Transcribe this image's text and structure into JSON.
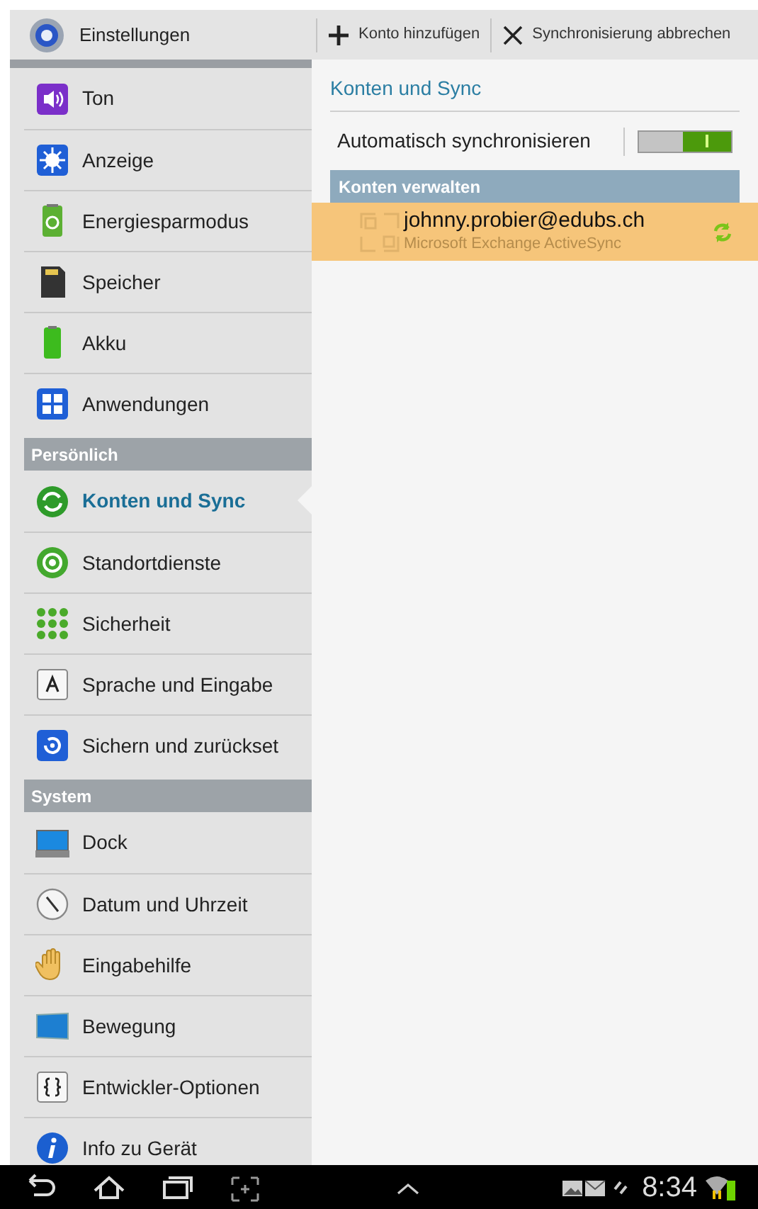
{
  "action_bar": {
    "title": "Einstellungen",
    "actions": [
      "Konto hinzufügen",
      "Synchronisierung abbrechen"
    ]
  },
  "sidebar": {
    "sections": [
      {
        "items": [
          {
            "label": "Ton",
            "selected": false
          },
          {
            "label": "Anzeige",
            "selected": false
          },
          {
            "label": "Energiesparmodus",
            "selected": false
          },
          {
            "label": "Speicher",
            "selected": false
          },
          {
            "label": "Akku",
            "selected": false
          },
          {
            "label": "Anwendungen",
            "selected": false
          }
        ]
      },
      {
        "header": "Persönlich",
        "items": [
          {
            "label": "Konten und Sync",
            "selected": true
          },
          {
            "label": "Standortdienste",
            "selected": false
          },
          {
            "label": "Sicherheit",
            "selected": false
          },
          {
            "label": "Sprache und Eingabe",
            "selected": false
          },
          {
            "label": "Sichern und zurückset",
            "selected": false
          }
        ]
      },
      {
        "header": "System",
        "items": [
          {
            "label": "Dock",
            "selected": false
          },
          {
            "label": "Datum und Uhrzeit",
            "selected": false
          },
          {
            "label": "Eingabehilfe",
            "selected": false
          },
          {
            "label": "Bewegung",
            "selected": false
          },
          {
            "label": "Entwickler-Optionen",
            "selected": false
          },
          {
            "label": "Info zu Gerät",
            "selected": false
          }
        ]
      }
    ]
  },
  "detail": {
    "title": "Konten und Sync",
    "auto_sync": {
      "label": "Automatisch synchronisieren",
      "on": true
    },
    "accounts_header": "Konten verwalten",
    "accounts": [
      {
        "email": "johnny.probier@edubs.ch",
        "type": "Microsoft Exchange ActiveSync",
        "selected": true
      }
    ]
  },
  "status_bar": {
    "time": "8:34"
  }
}
